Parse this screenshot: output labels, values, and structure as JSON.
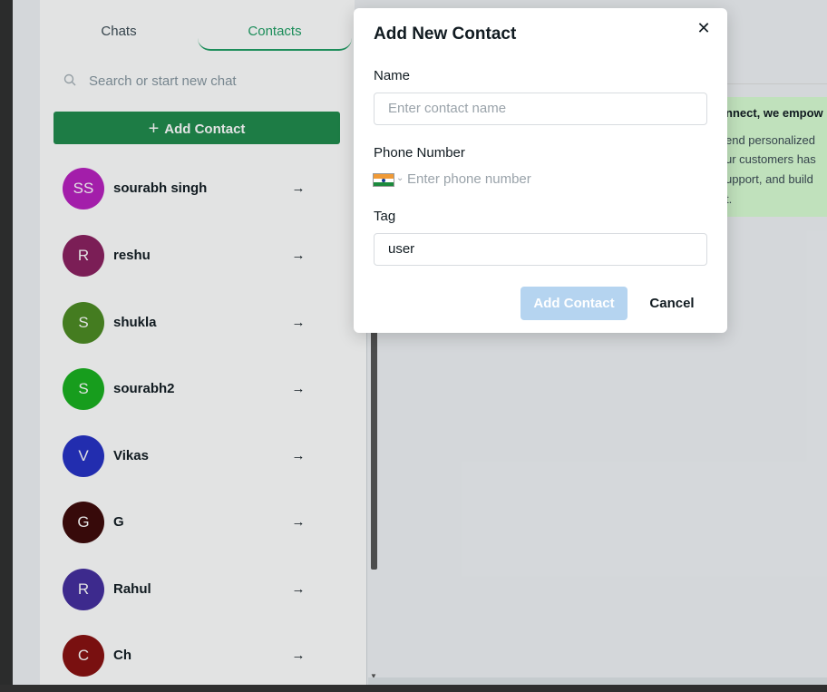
{
  "sidebar": {
    "tabs": [
      {
        "label": "Chats",
        "active": false
      },
      {
        "label": "Contacts",
        "active": true
      }
    ],
    "search": {
      "placeholder": "Search or start new chat",
      "icon": "search-icon"
    },
    "add_contact_button": {
      "label": "Add Contact",
      "icon": "plus-icon"
    },
    "contacts": [
      {
        "initials": "SS",
        "name": "sourabh singh",
        "color": "#b81fbf"
      },
      {
        "initials": "R",
        "name": "reshu",
        "color": "#8a1f5f"
      },
      {
        "initials": "S",
        "name": "shukla",
        "color": "#4c8a22"
      },
      {
        "initials": "S",
        "name": "sourabh2",
        "color": "#18b01e"
      },
      {
        "initials": "V",
        "name": "Vikas",
        "color": "#2530c4"
      },
      {
        "initials": "G",
        "name": "G",
        "color": "#3d0808"
      },
      {
        "initials": "R",
        "name": "Rahul",
        "color": "#442d9e"
      },
      {
        "initials": "C",
        "name": "Ch",
        "color": "#880f0f"
      }
    ],
    "contact_action_icon": "arrow-right-icon"
  },
  "welcome_card": {
    "title": "nnect, we empow",
    "lines": [
      "end personalized",
      "ur customers has",
      "upport, and build",
      "t."
    ]
  },
  "modal": {
    "title": "Add New Contact",
    "close_icon": "close-icon",
    "name_label": "Name",
    "name_placeholder": "Enter contact name",
    "phone_label": "Phone Number",
    "phone_country_icon": "india-flag-icon",
    "phone_placeholder": "Enter phone number",
    "tag_label": "Tag",
    "tag_value": "user",
    "submit_label": "Add Contact",
    "cancel_label": "Cancel"
  },
  "colors": {
    "accent": "#1f8a4c",
    "active_tab": "#1e9e63",
    "welcome_bg": "#d9fdd3",
    "disabled_button": "#b5d4f0"
  }
}
